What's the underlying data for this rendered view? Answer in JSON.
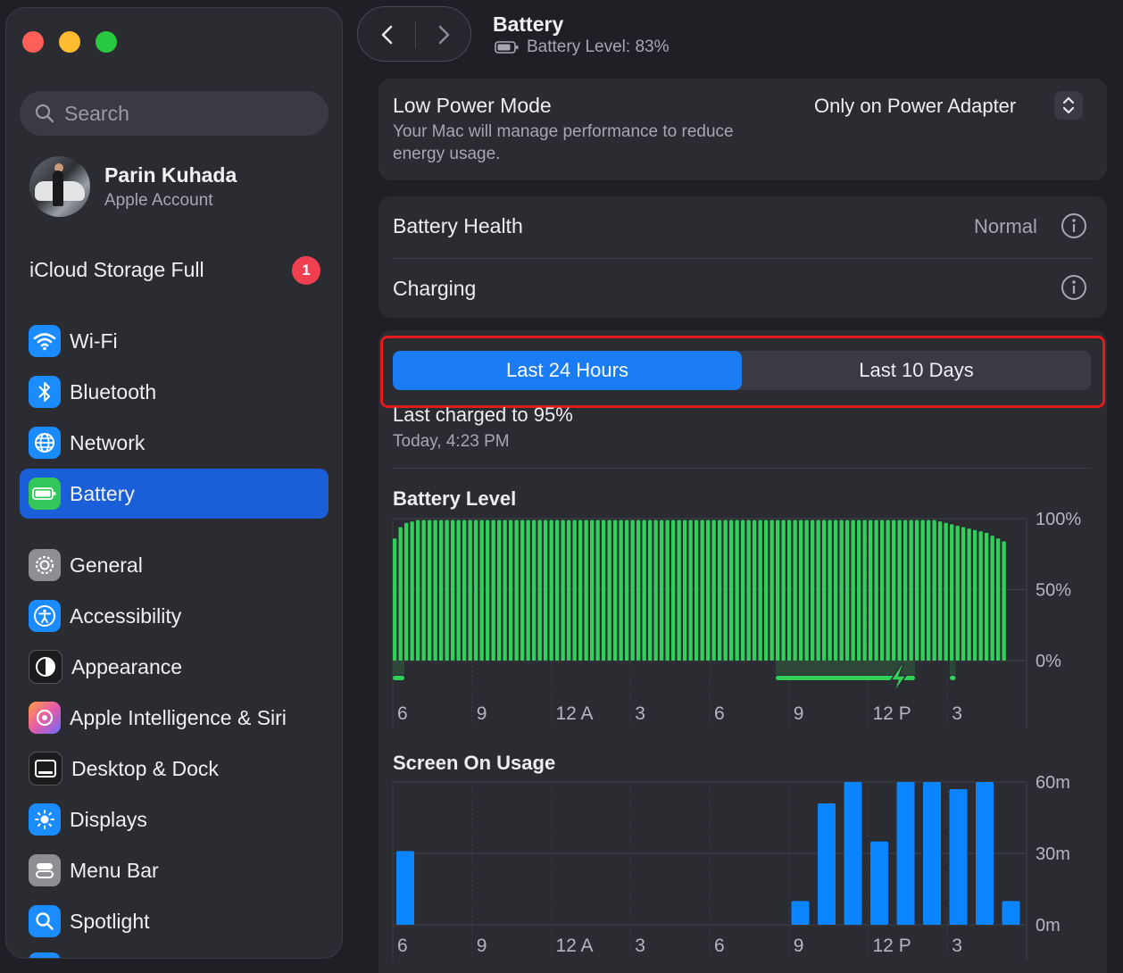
{
  "window": {
    "title": "Battery",
    "subtitle": "Battery Level: 83%"
  },
  "sidebar": {
    "search_placeholder": "Search",
    "account": {
      "name": "Parin Kuhada",
      "subtitle": "Apple Account"
    },
    "icloud": {
      "label": "iCloud Storage Full",
      "badge": "1"
    },
    "items": [
      {
        "label": "Wi-Fi",
        "icon": "wifi-icon",
        "color": "#1a8cff"
      },
      {
        "label": "Bluetooth",
        "icon": "bluetooth-icon",
        "color": "#1a8cff"
      },
      {
        "label": "Network",
        "icon": "network-globe-icon",
        "color": "#1a8cff"
      },
      {
        "label": "Battery",
        "icon": "battery-icon",
        "color": "#33c759",
        "active": true
      },
      {
        "label": "General",
        "icon": "gear-icon",
        "color": "#8e8e93"
      },
      {
        "label": "Accessibility",
        "icon": "accessibility-icon",
        "color": "#1a8cff"
      },
      {
        "label": "Appearance",
        "icon": "appearance-icon",
        "color": "#1c1c1e"
      },
      {
        "label": "Apple Intelligence & Siri",
        "icon": "siri-icon",
        "color": "#e55aa8"
      },
      {
        "label": "Desktop & Dock",
        "icon": "dock-icon",
        "color": "#1c1c1e"
      },
      {
        "label": "Displays",
        "icon": "displays-sun-icon",
        "color": "#1a8cff"
      },
      {
        "label": "Menu Bar",
        "icon": "menu-bar-icon",
        "color": "#8e8e93"
      },
      {
        "label": "Spotlight",
        "icon": "spotlight-search-icon",
        "color": "#1a8cff"
      }
    ]
  },
  "low_power": {
    "label": "Low Power Mode",
    "description_line1": "Your Mac will manage performance to reduce",
    "description_line2": "energy usage.",
    "value": "Only on Power Adapter"
  },
  "health": {
    "label": "Battery Health",
    "value": "Normal"
  },
  "charging": {
    "label": "Charging"
  },
  "segmented": {
    "options": [
      "Last 24 Hours",
      "Last 10 Days"
    ],
    "selected": 0
  },
  "last_charged": {
    "title": "Last charged to 95%",
    "time": "Today, 4:23 PM"
  },
  "colors": {
    "accent": "#1a7cf5",
    "battery_green": "#30d158",
    "usage_blue": "#0a84ff",
    "highlight_red": "#e21c1c"
  },
  "chart_data": [
    {
      "type": "bar",
      "title": "Battery Level",
      "x_ticks": [
        "6",
        "9",
        "12 A",
        "3",
        "6",
        "9",
        "12 P",
        "3"
      ],
      "y_ticks": [
        "100%",
        "50%",
        "0%"
      ],
      "ylim": [
        0,
        100
      ],
      "values": [
        86,
        94,
        97,
        98,
        99,
        99,
        99,
        99,
        99,
        99,
        99,
        99,
        99,
        99,
        99,
        99,
        99,
        99,
        99,
        99,
        99,
        99,
        99,
        99,
        99,
        99,
        99,
        99,
        99,
        99,
        99,
        99,
        99,
        99,
        99,
        99,
        99,
        99,
        99,
        99,
        99,
        99,
        99,
        99,
        99,
        99,
        99,
        99,
        99,
        99,
        99,
        99,
        99,
        99,
        99,
        99,
        99,
        99,
        99,
        99,
        99,
        99,
        99,
        99,
        99,
        99,
        99,
        99,
        99,
        99,
        99,
        99,
        99,
        99,
        99,
        99,
        99,
        99,
        99,
        99,
        99,
        99,
        99,
        99,
        99,
        99,
        99,
        99,
        99,
        99,
        99,
        99,
        99,
        99,
        98,
        97,
        96,
        95,
        94,
        93,
        92,
        91,
        90,
        88,
        86,
        84
      ],
      "charging_segments": [
        [
          0,
          2
        ],
        [
          66,
          90
        ],
        [
          96,
          97
        ]
      ]
    },
    {
      "type": "bar",
      "title": "Screen On Usage",
      "x_ticks": [
        "6",
        "9",
        "12 A",
        "3",
        "6",
        "9",
        "12 P",
        "3"
      ],
      "y_ticks": [
        "60m",
        "30m",
        "0m"
      ],
      "ylim": [
        0,
        60
      ],
      "unit": "minutes",
      "values": [
        31,
        0,
        0,
        0,
        0,
        0,
        0,
        0,
        0,
        0,
        0,
        0,
        0,
        0,
        0,
        10,
        51,
        60,
        35,
        60,
        60,
        57,
        60,
        10
      ]
    }
  ]
}
